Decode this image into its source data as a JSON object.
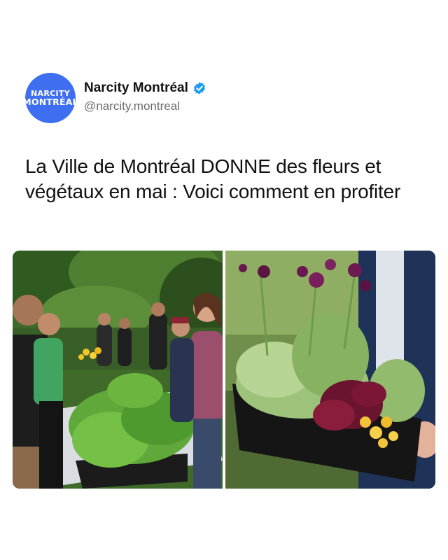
{
  "account": {
    "avatar_line1": "NARCITY",
    "avatar_line2": "MONTRÉAL",
    "display_name": "Narcity Montréal",
    "handle": "@narcity.montreal",
    "verified": true,
    "verified_icon": "verified-badge-icon",
    "avatar_color": "#3f6ff0",
    "badge_color": "#1d9bf0"
  },
  "post": {
    "headline": "La Ville de Montréal DONNE des fleurs et végétaux en mai : Voici comment en profiter"
  },
  "images": [
    {
      "name": "photo-plant-giveaway-crowd"
    },
    {
      "name": "photo-flower-tray"
    }
  ]
}
